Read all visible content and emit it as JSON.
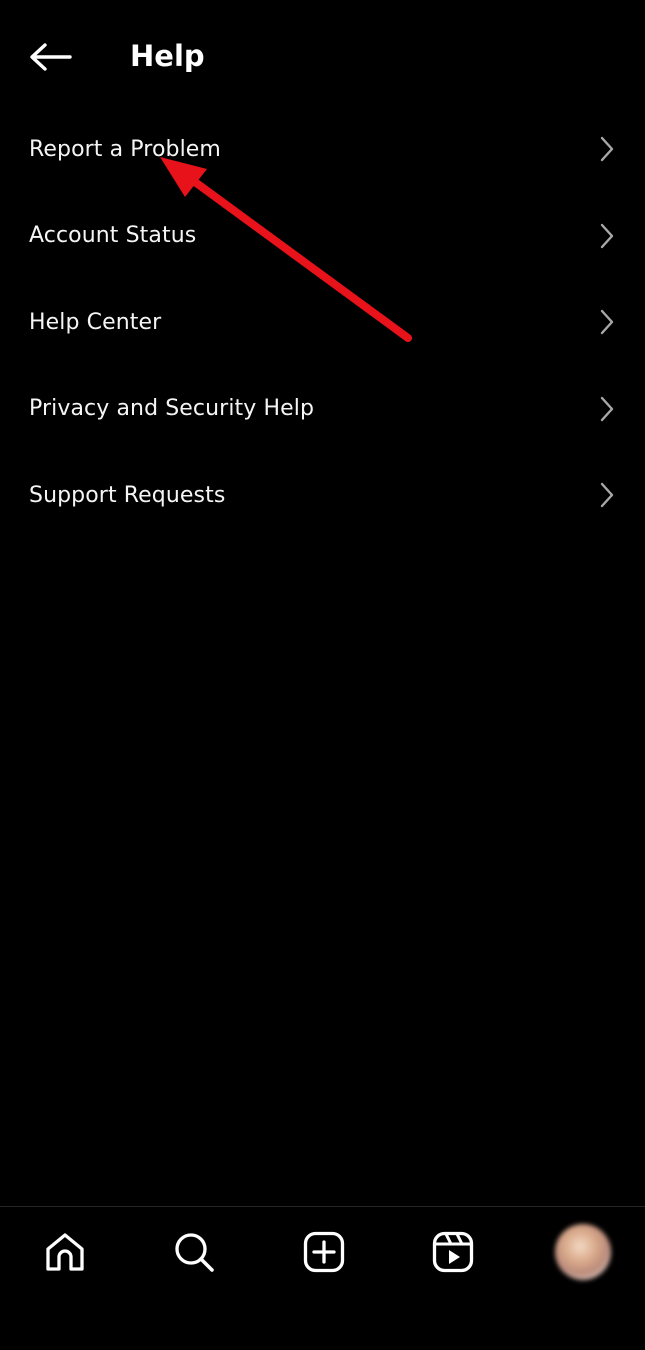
{
  "header": {
    "title": "Help",
    "back_icon": "arrow-left-icon"
  },
  "menu": {
    "items": [
      {
        "label": "Report a Problem",
        "icon": "chevron-right-icon"
      },
      {
        "label": "Account Status",
        "icon": "chevron-right-icon"
      },
      {
        "label": "Help Center",
        "icon": "chevron-right-icon"
      },
      {
        "label": "Privacy and Security Help",
        "icon": "chevron-right-icon"
      },
      {
        "label": "Support Requests",
        "icon": "chevron-right-icon"
      }
    ]
  },
  "annotation": {
    "type": "arrow",
    "color": "#e8121a",
    "points_to": "Report a Problem"
  },
  "bottom_nav": {
    "items": [
      {
        "icon": "home-icon"
      },
      {
        "icon": "search-icon"
      },
      {
        "icon": "create-post-icon"
      },
      {
        "icon": "reels-icon"
      },
      {
        "icon": "profile-avatar"
      }
    ]
  },
  "colors": {
    "background": "#000000",
    "text": "#ffffff",
    "chevron": "#a8a8a8",
    "divider": "#262626"
  }
}
